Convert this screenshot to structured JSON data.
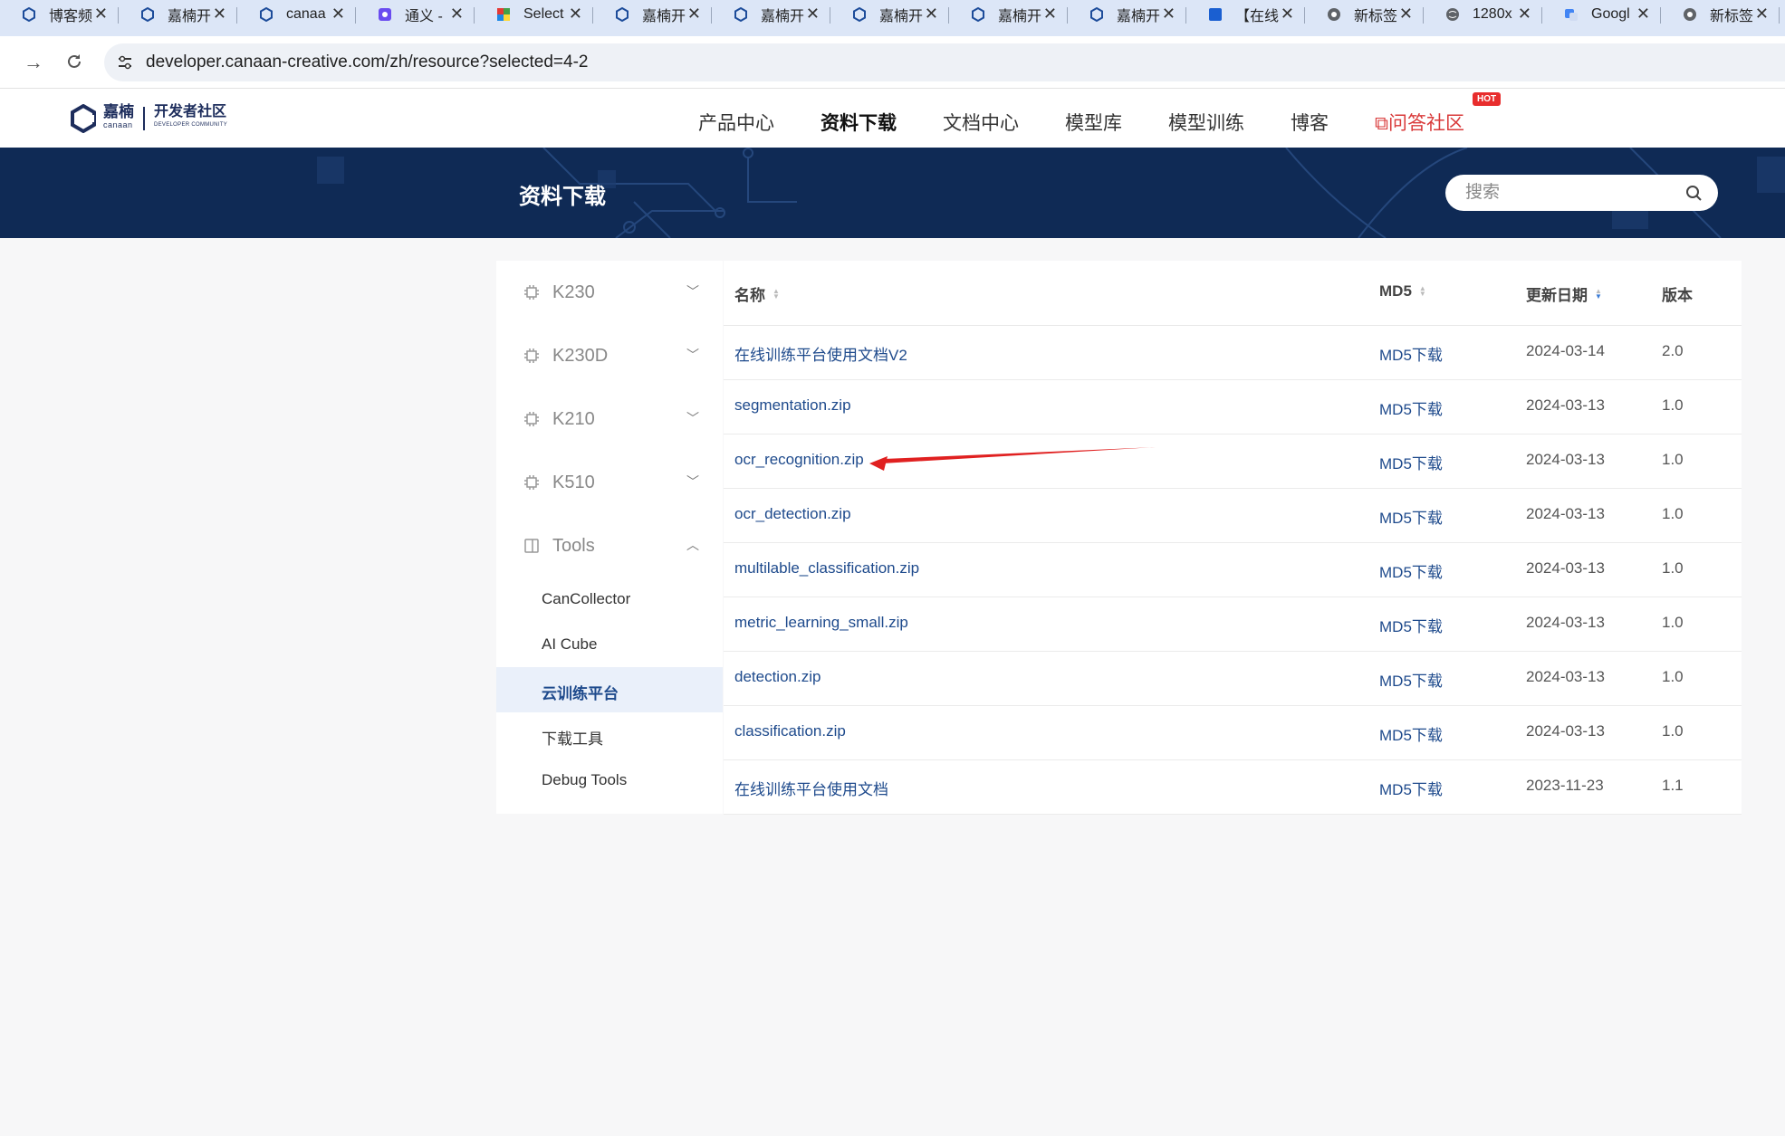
{
  "browser": {
    "tabs": [
      {
        "label": "博客频",
        "icon": "canaan-icon"
      },
      {
        "label": "嘉楠开",
        "icon": "canaan-icon"
      },
      {
        "label": "canaa",
        "icon": "canaan-icon"
      },
      {
        "label": "通义 -",
        "icon": "tongyi-icon"
      },
      {
        "label": "Select",
        "icon": "color-blocks-icon"
      },
      {
        "label": "嘉楠开",
        "icon": "canaan-icon"
      },
      {
        "label": "嘉楠开",
        "icon": "canaan-icon"
      },
      {
        "label": "嘉楠开",
        "icon": "canaan-icon"
      },
      {
        "label": "嘉楠开",
        "icon": "canaan-icon"
      },
      {
        "label": "嘉楠开",
        "icon": "canaan-icon"
      },
      {
        "label": "【在线",
        "icon": "blue-square-icon"
      },
      {
        "label": "新标签",
        "icon": "chrome-icon"
      },
      {
        "label": "1280x",
        "icon": "globe-icon"
      },
      {
        "label": "Googl",
        "icon": "google-translate-icon"
      },
      {
        "label": "新标签",
        "icon": "chrome-icon"
      }
    ],
    "url": "developer.canaan-creative.com/zh/resource?selected=4-2"
  },
  "header": {
    "logo": {
      "brand": "嘉楠",
      "brand_sub": "canaan",
      "community": "开发者社区",
      "community_sub": "DEVELOPER COMMUNITY"
    },
    "nav": [
      "产品中心",
      "资料下载",
      "文档中心",
      "模型库",
      "模型训练",
      "博客",
      "问答社区"
    ],
    "active_nav": "资料下载",
    "hot_badge": "HOT"
  },
  "banner": {
    "title": "资料下载",
    "search_placeholder": "搜索"
  },
  "sidebar": {
    "groups": [
      {
        "label": "K230",
        "icon": "chip-icon",
        "expanded": false
      },
      {
        "label": "K230D",
        "icon": "chip-icon",
        "expanded": false
      },
      {
        "label": "K210",
        "icon": "chip-icon",
        "expanded": false
      },
      {
        "label": "K510",
        "icon": "chip-icon",
        "expanded": false
      },
      {
        "label": "Tools",
        "icon": "tools-icon",
        "expanded": true
      }
    ],
    "tools_items": [
      "CanCollector",
      "AI Cube",
      "云训练平台",
      "下载工具",
      "Debug Tools"
    ],
    "selected_item": "云训练平台"
  },
  "table": {
    "headers": {
      "name": "名称",
      "md5": "MD5",
      "date": "更新日期",
      "version": "版本"
    },
    "rows": [
      {
        "name": "在线训练平台使用文档V2",
        "md5": "MD5下载",
        "date": "2024-03-14",
        "version": "2.0"
      },
      {
        "name": "segmentation.zip",
        "md5": "MD5下载",
        "date": "2024-03-13",
        "version": "1.0"
      },
      {
        "name": "ocr_recognition.zip",
        "md5": "MD5下载",
        "date": "2024-03-13",
        "version": "1.0"
      },
      {
        "name": "ocr_detection.zip",
        "md5": "MD5下载",
        "date": "2024-03-13",
        "version": "1.0"
      },
      {
        "name": "multilable_classification.zip",
        "md5": "MD5下载",
        "date": "2024-03-13",
        "version": "1.0"
      },
      {
        "name": "metric_learning_small.zip",
        "md5": "MD5下载",
        "date": "2024-03-13",
        "version": "1.0"
      },
      {
        "name": "detection.zip",
        "md5": "MD5下载",
        "date": "2024-03-13",
        "version": "1.0"
      },
      {
        "name": "classification.zip",
        "md5": "MD5下载",
        "date": "2024-03-13",
        "version": "1.0"
      },
      {
        "name": "在线训练平台使用文档",
        "md5": "MD5下载",
        "date": "2023-11-23",
        "version": "1.1"
      }
    ]
  },
  "colors": {
    "accent": "#1e4a8c",
    "banner": "#0f2a55",
    "hot": "#e82d2d",
    "annotation_arrow": "#e02020"
  }
}
